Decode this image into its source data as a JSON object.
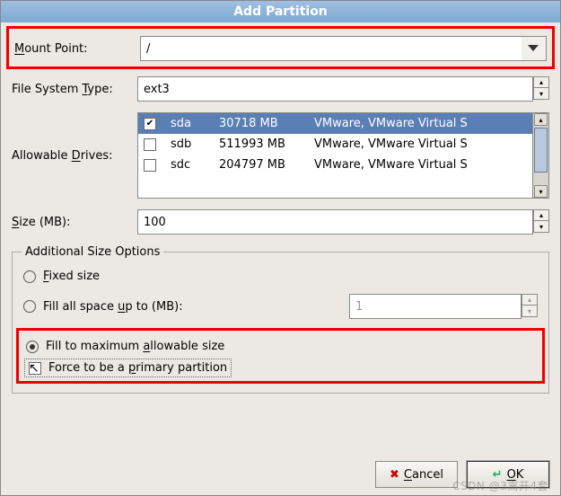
{
  "title": "Add Partition",
  "labels": {
    "mount_point_pre": "M",
    "mount_point_post": "ount Point:",
    "fs_type_pre": "File System ",
    "fs_type_u": "T",
    "fs_type_post": "ype:",
    "drives_pre": "Allowable ",
    "drives_u": "D",
    "drives_post": "rives:",
    "size_pre": "S",
    "size_post": "ize (MB):"
  },
  "mount_point": {
    "value": "/"
  },
  "fs_type": {
    "value": "ext3"
  },
  "drives": [
    {
      "checked": true,
      "name": "sda",
      "size": "30718 MB",
      "desc": "VMware, VMware Virtual S",
      "selected": true
    },
    {
      "checked": false,
      "name": "sdb",
      "size": "511993 MB",
      "desc": "VMware, VMware Virtual S",
      "selected": false
    },
    {
      "checked": false,
      "name": "sdc",
      "size": "204797 MB",
      "desc": "VMware, VMware Virtual S",
      "selected": false
    }
  ],
  "size_mb": {
    "value": "100"
  },
  "size_options": {
    "legend": "Additional Size Options",
    "fixed_pre": "F",
    "fixed_post": "ixed size",
    "fill_up_pre": "Fill all space ",
    "fill_up_u": "u",
    "fill_up_post": "p to (MB):",
    "fill_up_value": "1",
    "fill_max_pre": "Fill to maximum ",
    "fill_max_u": "a",
    "fill_max_post": "llowable size",
    "selected": "fill_max"
  },
  "force_primary": {
    "checked": true,
    "pre": "Force to be a ",
    "u": "p",
    "post": "rimary partition"
  },
  "buttons": {
    "cancel_u": "C",
    "cancel_post": "ancel",
    "ok_u": "O",
    "ok_post": "K"
  },
  "icons": {
    "x": "✖",
    "ok": "↵"
  },
  "watermark": "CSDN @3离开4套"
}
